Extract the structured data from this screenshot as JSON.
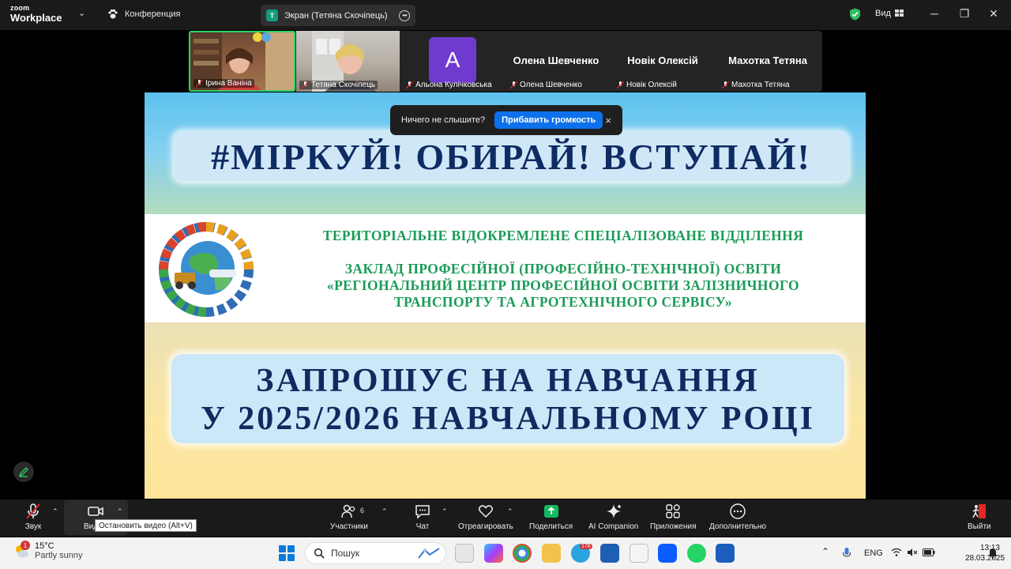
{
  "app": {
    "logo_line1": "zoom",
    "logo_line2": "Workplace",
    "meeting_title": "Конференция",
    "share_avatar_letter": "Т",
    "share_label": "Экран (Тетяна Скочіпець)",
    "view_label": "Вид",
    "accent": "#0e71eb"
  },
  "participants": [
    {
      "name": "Ірина Ваніна",
      "muted": true
    },
    {
      "name": "Тетяна Скочіпець",
      "muted": true
    },
    {
      "name": "Альона Кулічковська",
      "muted": true,
      "avatar_letter": "A",
      "avatar_color": "#6f3bcf"
    },
    {
      "name": "Олена Шевченко",
      "muted": true
    },
    {
      "name": "Новік Олексій",
      "muted": true
    },
    {
      "name": "Махотка Тетяна",
      "muted": true
    }
  ],
  "toast": {
    "message": "Ничего не слышите?",
    "button": "Прибавить громкость",
    "close": "×"
  },
  "slide": {
    "banner_top": "#МІРКУЙ! ОБИРАЙ! ВСТУПАЙ!",
    "org_line1": "ТЕРИТОРІАЛЬНЕ ВІДОКРЕМЛЕНЕ СПЕЦІАЛІЗОВАНЕ ВІДДІЛЕННЯ",
    "org_line2": "ЗАКЛАД ПРОФЕСІЙНОЇ (ПРОФЕСІЙНО-ТЕХНІЧНОЇ) ОСВІТИ",
    "org_line3": "«РЕГІОНАЛЬНИЙ ЦЕНТР ПРОФЕСІЙНОЇ ОСВІТИ ЗАЛІЗНИЧНОГО",
    "org_line4": "ТРАНСПОРТУ ТА АГРОТЕХНІЧНОГО СЕРВІСУ»",
    "banner_bottom_line1": "ЗАПРОШУЄ НА НАВЧАННЯ",
    "banner_bottom_line2": "У 2025/2026 НАВЧАЛЬНОМУ РОЦІ"
  },
  "toolbar": {
    "audio": "Звук",
    "video": "Видео",
    "video_tooltip": "Остановить видео (Alt+V)",
    "participants": "Участники",
    "participants_count": "6",
    "chat": "Чат",
    "react": "Отреагировать",
    "share": "Поделиться",
    "ai": "AI Companion",
    "apps": "Приложения",
    "more": "Дополнительно",
    "leave": "Выйти"
  },
  "taskbar": {
    "weather_temp": "15°C",
    "weather_desc": "Partly sunny",
    "weather_badge": "1",
    "search_placeholder": "Пошук",
    "telegram_badge": "178",
    "language": "ENG",
    "time": "13:13",
    "date": "28.03.2025"
  }
}
